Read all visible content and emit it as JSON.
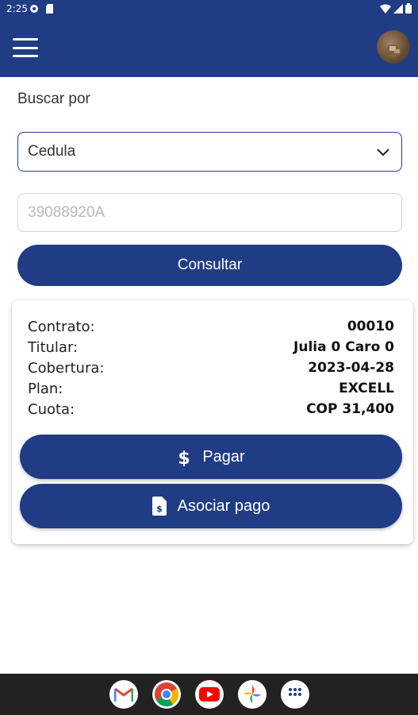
{
  "status_bar": {
    "time": "2:25"
  },
  "header": {
    "menu_icon": "hamburger-menu-icon",
    "avatar": "user-avatar"
  },
  "search": {
    "label": "Buscar por",
    "select_value": "Cedula",
    "input_placeholder": "39088920A",
    "submit_label": "Consultar"
  },
  "result": {
    "rows": [
      {
        "key": "Contrato:",
        "value": "00010"
      },
      {
        "key": "Titular:",
        "value": "Julia 0 Caro 0"
      },
      {
        "key": "Cobertura:",
        "value": "2023-04-28"
      },
      {
        "key": "Plan:",
        "value": "EXCELL"
      },
      {
        "key": "Cuota:",
        "value": "COP 31,400"
      }
    ],
    "pay_label": "Pagar",
    "associate_label": "Asociar pago"
  },
  "dock": {
    "apps": [
      "gmail-icon",
      "chrome-icon",
      "youtube-icon",
      "photos-icon",
      "app-drawer-icon"
    ]
  },
  "colors": {
    "primary": "#1f3c85",
    "nav_background": "#222222"
  }
}
